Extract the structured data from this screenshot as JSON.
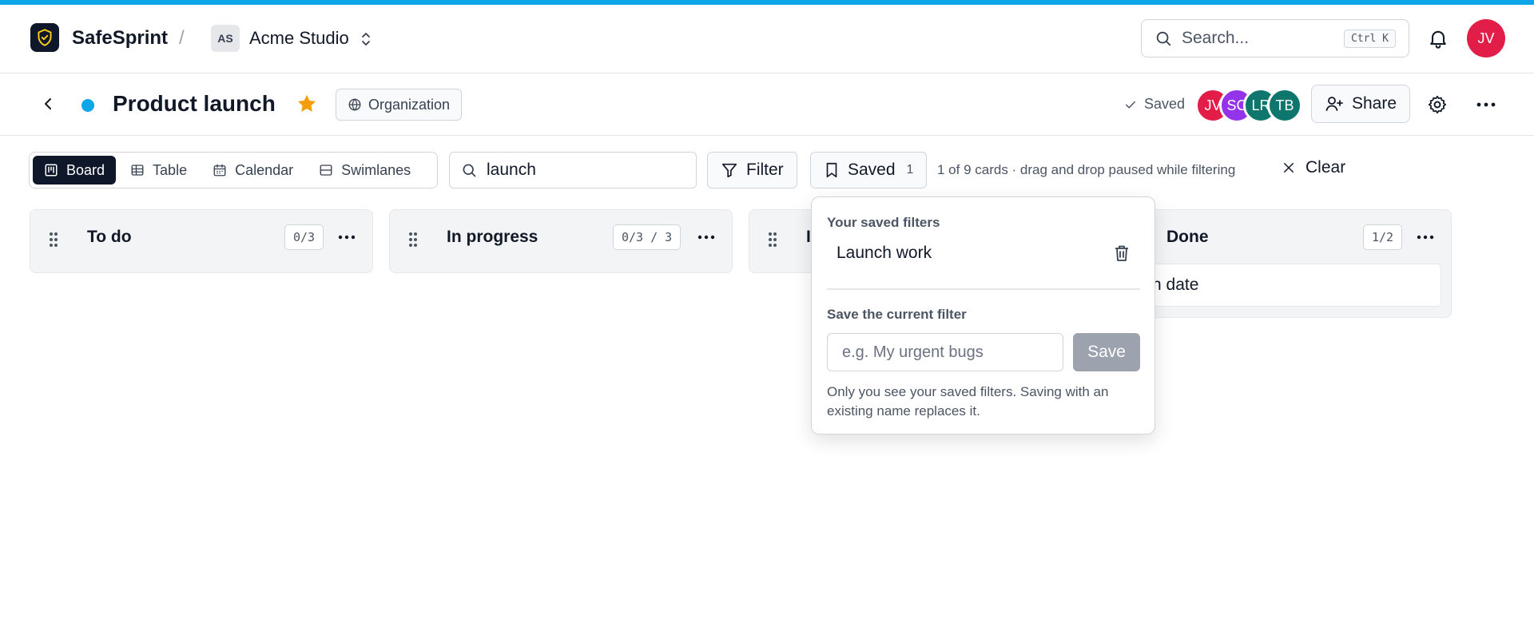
{
  "colors": {
    "accent": "#0ea5e9",
    "brand_dark": "#0f172a",
    "star": "#f59e0b",
    "avatar_jv": "#e11d48",
    "avatar_sc": "#9333ea",
    "avatar_lr": "#0f766e",
    "avatar_tb": "#0f766e"
  },
  "app": {
    "name": "SafeSprint",
    "breadcrumb_separator": "/",
    "org_initials": "AS",
    "org_name": "Acme Studio",
    "logo_icon": "shield-check-icon"
  },
  "header": {
    "search_placeholder": "Search...",
    "search_shortcut": "Ctrl K",
    "user_initials": "JV"
  },
  "page": {
    "title": "Product launch",
    "visibility": "Organization",
    "save_state": "Saved",
    "members": [
      "JV",
      "SC",
      "LR",
      "TB"
    ],
    "share_label": "Share"
  },
  "toolbar": {
    "views": [
      "Board",
      "Table",
      "Calendar",
      "Swimlanes"
    ],
    "active_view": "Board",
    "search_value": "launch",
    "filter_label": "Filter",
    "saved_label": "Saved",
    "saved_count": "1",
    "filter_info": "1 of 9 cards · drag and drop paused while filtering",
    "clear_label": "Clear"
  },
  "columns": [
    {
      "title": "To do",
      "count": "0/3"
    },
    {
      "title": "In progress",
      "count": "0/3 / 3"
    },
    {
      "title": "I",
      "count": ""
    },
    {
      "title": "Done",
      "count": "1/2"
    }
  ],
  "cards": [
    {
      "column": "Done",
      "title": "ck launch date"
    }
  ],
  "saved_filters_popover": {
    "heading": "Your saved filters",
    "items": [
      "Launch work"
    ],
    "save_heading": "Save the current filter",
    "input_placeholder": "e.g. My urgent bugs",
    "save_button": "Save",
    "note": "Only you see your saved filters. Saving with an existing name replaces it."
  }
}
